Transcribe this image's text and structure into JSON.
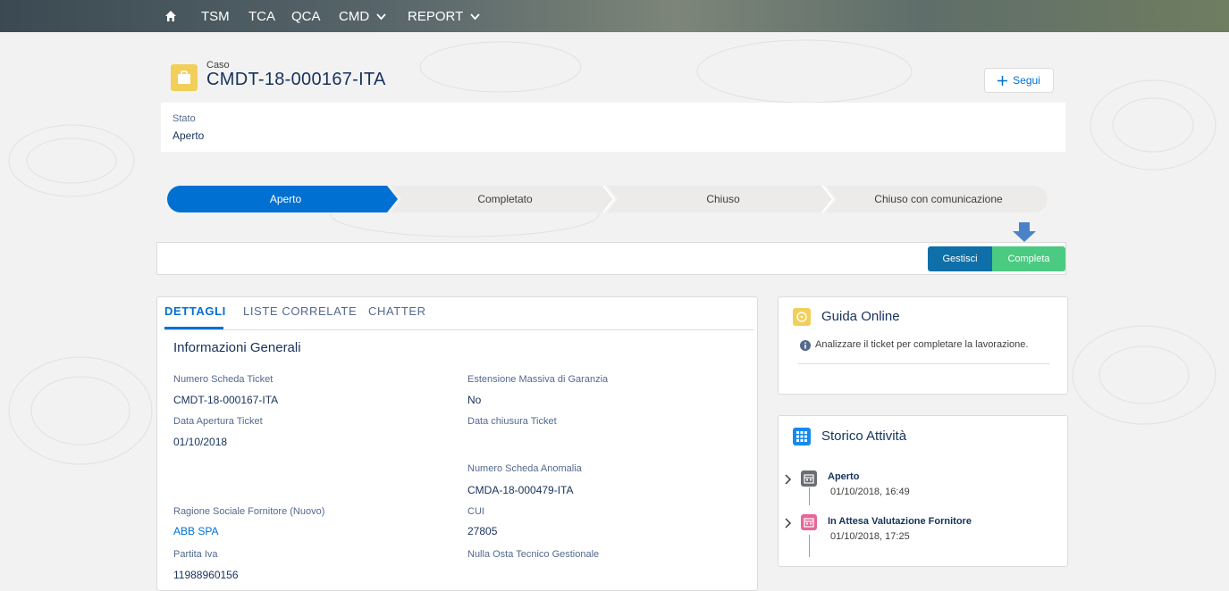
{
  "nav": {
    "items": [
      {
        "label": "TSM"
      },
      {
        "label": "TCA"
      },
      {
        "label": "QCA"
      },
      {
        "label": "CMD",
        "dropdown": true
      },
      {
        "label": "REPORT",
        "dropdown": true
      }
    ]
  },
  "record": {
    "object_label": "Caso",
    "number": "CMDT-18-000167-ITA",
    "follow_label": "Segui"
  },
  "status": {
    "label": "Stato",
    "value": "Aperto"
  },
  "path": {
    "steps": [
      "Aperto",
      "Completato",
      "Chiuso",
      "Chiuso con comunicazione"
    ],
    "active_index": 0
  },
  "actions": {
    "manage_label": "Gestisci",
    "complete_label": "Completa"
  },
  "tabs": [
    "DETTAGLI",
    "LISTE CORRELATE",
    "CHATTER"
  ],
  "details": {
    "section_title": "Informazioni Generali",
    "fields": {
      "numero_scheda_ticket": {
        "label": "Numero Scheda Ticket",
        "value": "CMDT-18-000167-ITA"
      },
      "estensione_massiva": {
        "label": "Estensione Massiva di Garanzia",
        "value": "No"
      },
      "data_apertura": {
        "label": "Data Apertura Ticket",
        "value": "01/10/2018"
      },
      "data_chiusura": {
        "label": "Data chiusura Ticket",
        "value": ""
      },
      "numero_scheda_anomalia": {
        "label": "Numero Scheda Anomalia",
        "value": "CMDA-18-000479-ITA"
      },
      "ragione_sociale": {
        "label": "Ragione Sociale Fornitore (Nuovo)",
        "value": "ABB SPA"
      },
      "cui": {
        "label": "CUI",
        "value": "27805"
      },
      "partita_iva": {
        "label": "Partita Iva",
        "value": "11988960156"
      },
      "nulla_osta": {
        "label": "Nulla Osta Tecnico Gestionale",
        "value": ""
      }
    }
  },
  "guida": {
    "title": "Guida Online",
    "text": "Analizzare il ticket per completare la lavorazione."
  },
  "storico": {
    "title": "Storico Attività",
    "items": [
      {
        "title": "Aperto",
        "date": "01/10/2018, 16:49"
      },
      {
        "title": "In Attesa Valutazione Fornitore",
        "date": "01/10/2018, 17:25"
      }
    ]
  },
  "colors": {
    "brand": "#0070d2",
    "path_active": "#0070d2",
    "complete_button": "#4bca81",
    "manage_button": "#0f6fa8",
    "case_icon": "#f2cf5b",
    "storico_icon": "#1589ee",
    "timeline_line": "#4bca81",
    "event_icon_1": "#6b6d70",
    "event_icon_2": "#e56798",
    "arrow": "#4a82c9"
  }
}
